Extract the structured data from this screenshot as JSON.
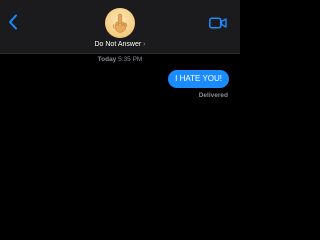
{
  "header": {
    "contact_name": "Do Not Answer",
    "chevron": "›",
    "avatar_icon": "middle-finger-emoji",
    "back_icon": "chevron-left-icon",
    "video_icon": "video-camera-icon"
  },
  "conversation": {
    "timestamp_day": "Today",
    "timestamp_time": "5:35 PM",
    "messages": [
      {
        "sender": "me",
        "text": "I HATE YOU!",
        "status": "Delivered"
      }
    ]
  },
  "colors": {
    "accent": "#1a8cff",
    "background": "#000000",
    "header_bg": "#1b1b1d",
    "secondary_text": "#8e8e93"
  }
}
